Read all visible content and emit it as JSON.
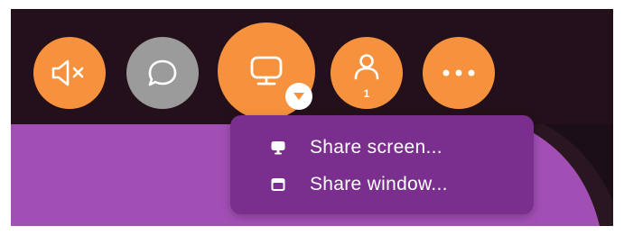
{
  "toolbar": {
    "buttons": [
      {
        "icon": "speaker-muted-icon",
        "color": "#f6923d"
      },
      {
        "icon": "chat-bubble-icon",
        "color": "#9b9b9b"
      },
      {
        "icon": "screen-share-icon",
        "color": "#f6923d"
      },
      {
        "icon": "participants-icon",
        "color": "#f6923d",
        "count": "1"
      },
      {
        "icon": "more-options-icon",
        "color": "#f6923d"
      }
    ],
    "share_caret_icon": "caret-down-icon"
  },
  "share_menu": {
    "items": [
      {
        "label": "Share screen...",
        "icon": "monitor-icon"
      },
      {
        "label": "Share window...",
        "icon": "window-icon"
      }
    ],
    "background": "#7a2f8e"
  },
  "colors": {
    "accent": "#f6923d",
    "toolbar_background": "#24101a",
    "stage_background": "#a24fb5"
  }
}
